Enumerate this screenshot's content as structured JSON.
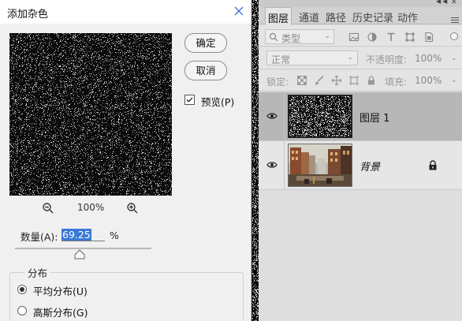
{
  "dialog": {
    "title": "添加杂色",
    "ok_label": "确定",
    "cancel_label": "取消",
    "preview_checkbox": {
      "label": "预览(P)",
      "checked": true
    },
    "zoom": "100%",
    "amount": {
      "label": "数量(A):",
      "value": "69.25",
      "unit": "%",
      "fraction": 0.4
    },
    "distribution": {
      "legend": "分布",
      "options": [
        {
          "label": "平均分布(U)",
          "selected": true
        },
        {
          "label": "高斯分布(G)",
          "selected": false
        }
      ]
    }
  },
  "layers_panel": {
    "tabs": [
      "图层",
      "通道",
      "路径",
      "历史记录",
      "动作"
    ],
    "active_tab": "图层",
    "filter_kind": "类型",
    "blend_mode": "正常",
    "opacity_label": "不透明度:",
    "opacity": "100%",
    "lock_label": "锁定:",
    "fill_label": "填充:",
    "fill": "100%",
    "layers": [
      {
        "name": "图层 1",
        "selected": true,
        "visible": true,
        "locked": false
      },
      {
        "name": "背景",
        "selected": false,
        "visible": true,
        "locked": true
      }
    ]
  },
  "icons": {
    "close": "close-icon",
    "zoom_out": "zoom-out-icon",
    "zoom_in": "zoom-in-icon",
    "eye": "eye-icon",
    "lock": "lock-icon"
  }
}
